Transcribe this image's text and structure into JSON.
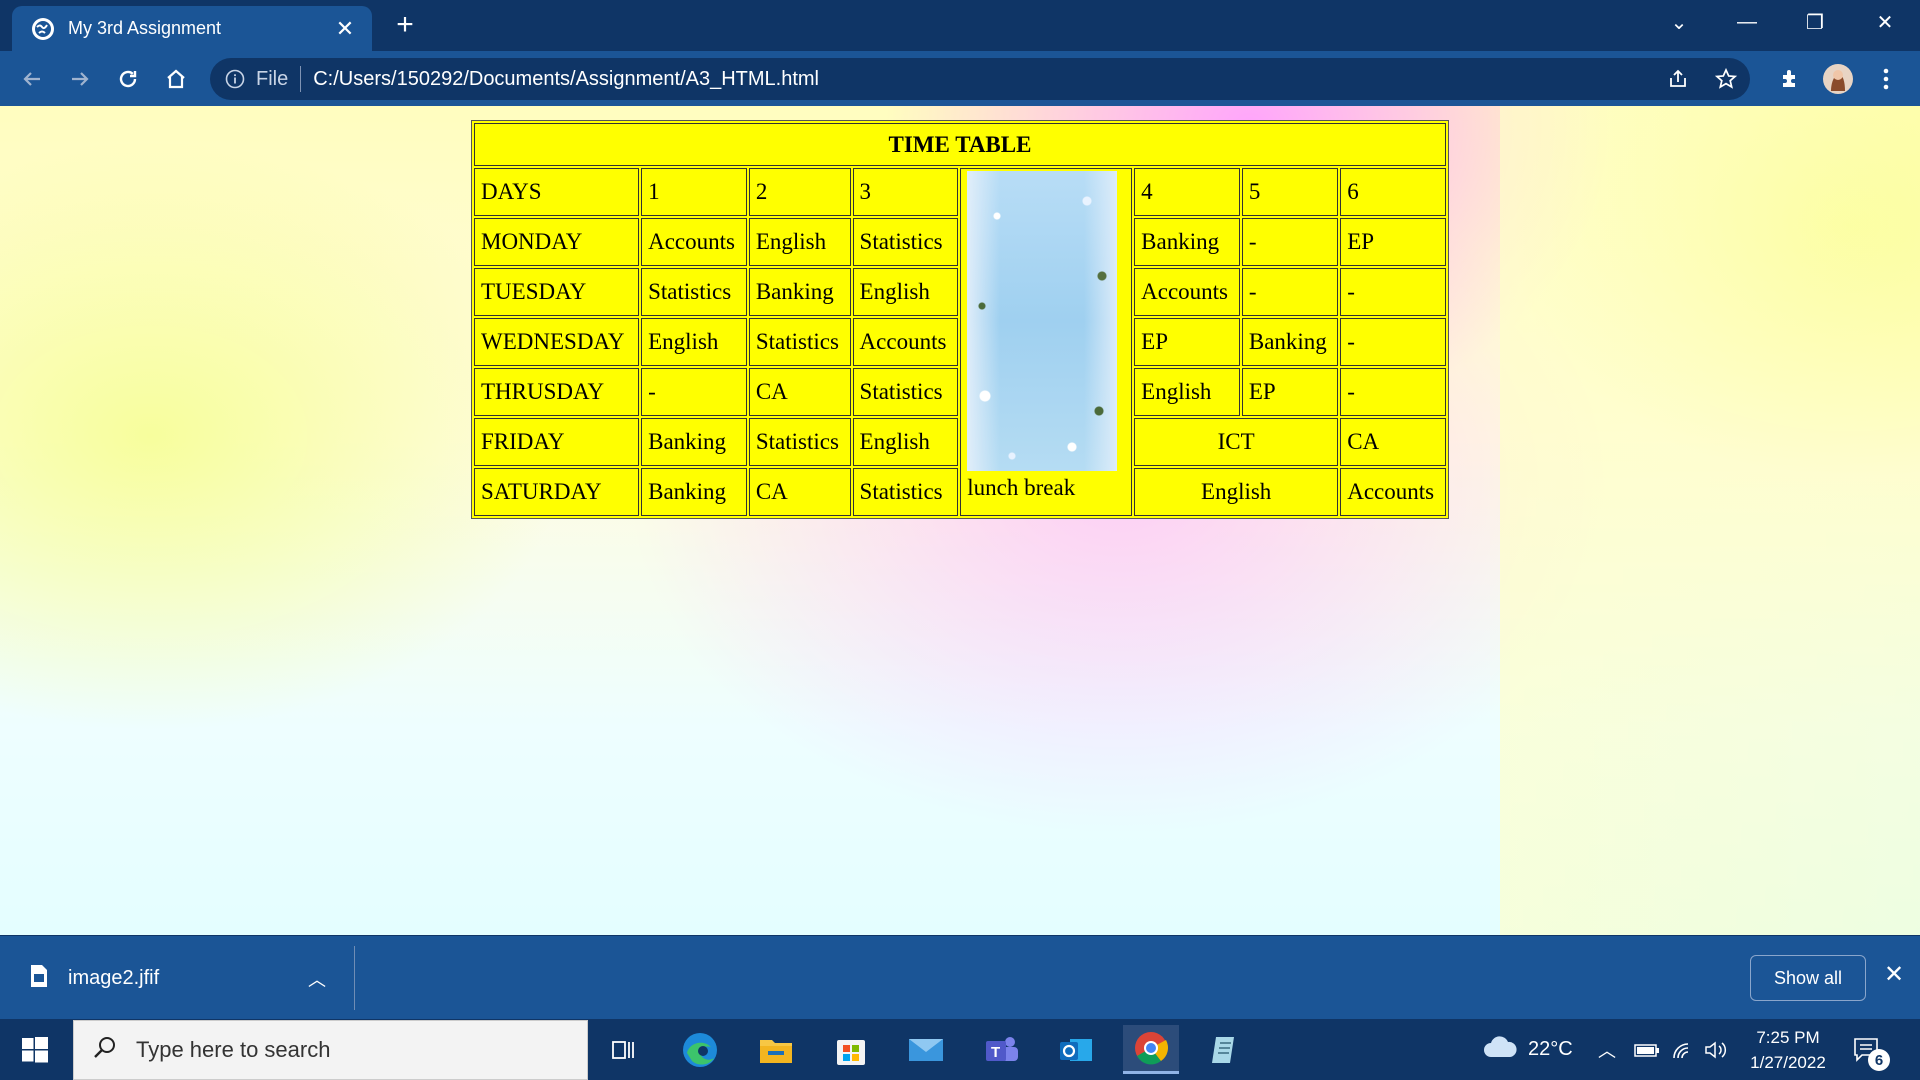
{
  "browser": {
    "tab_title": "My 3rd Assignment",
    "address_scheme": "File",
    "address_url": "C:/Users/150292/Documents/Assignment/A3_HTML.html"
  },
  "timetable": {
    "caption": "TIME TABLE",
    "header": [
      "DAYS",
      "1",
      "2",
      "3",
      "4",
      "5",
      "6"
    ],
    "lunch_label": "lunch break",
    "rows": [
      {
        "day": "MONDAY",
        "p1": "Accounts",
        "p2": "English",
        "p3": "Statistics",
        "p4": "Banking",
        "p5": "-",
        "p6": "EP"
      },
      {
        "day": "TUESDAY",
        "p1": "Statistics",
        "p2": "Banking",
        "p3": "English",
        "p4": "Accounts",
        "p5": "-",
        "p6": "-"
      },
      {
        "day": "WEDNESDAY",
        "p1": "English",
        "p2": "Statistics",
        "p3": "Accounts",
        "p4": "EP",
        "p5": "Banking",
        "p6": "-"
      },
      {
        "day": "THRUSDAY",
        "p1": "-",
        "p2": "CA",
        "p3": "Statistics",
        "p4": "English",
        "p5": "EP",
        "p6": "-"
      },
      {
        "day": "FRIDAY",
        "p1": "Banking",
        "p2": "Statistics",
        "p3": "English",
        "p45": "ICT",
        "p6": "CA"
      },
      {
        "day": "SATURDAY",
        "p1": "Banking",
        "p2": "CA",
        "p3": "Statistics",
        "p45": "English",
        "p6": "Accounts"
      }
    ]
  },
  "downloads": {
    "file_name": "image2.jfif",
    "show_all_label": "Show all"
  },
  "taskbar": {
    "search_placeholder": "Type here to search",
    "weather": "22°C",
    "time": "7:25 PM",
    "date": "1/27/2022",
    "notification_count": "6"
  },
  "colors": {
    "table_background": "#ffff00",
    "chrome_dark": "#0f3566",
    "chrome_light": "#1b5596"
  }
}
